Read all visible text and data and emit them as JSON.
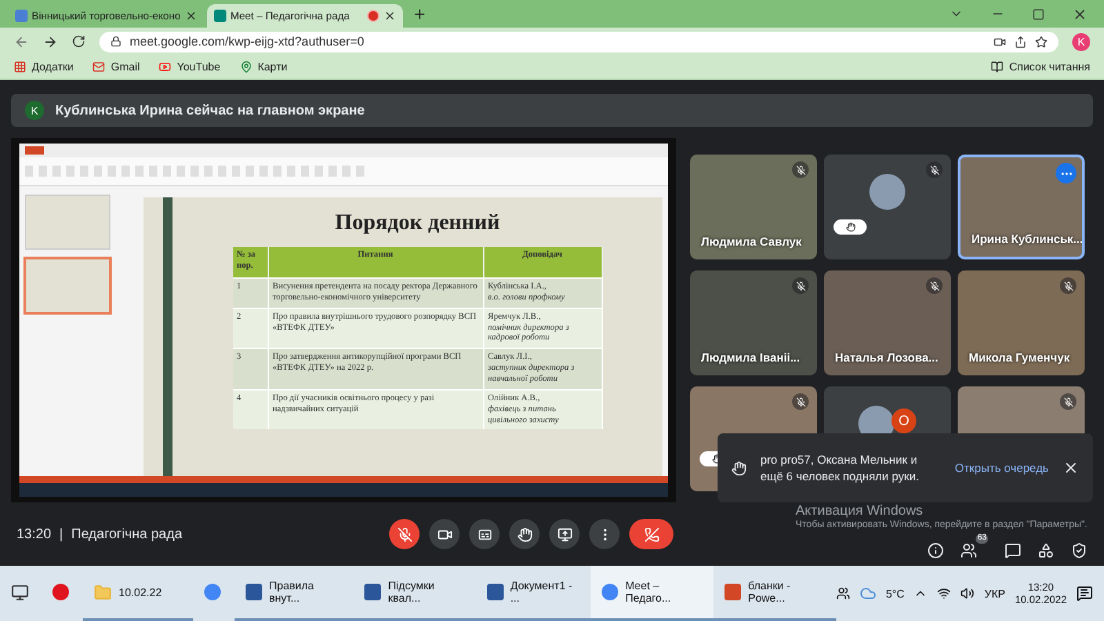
{
  "browser": {
    "tabs": [
      {
        "title": "Вінницький торговельно-еконо",
        "selected": false,
        "recording": false
      },
      {
        "title": "Meet – Педагогічна рада",
        "selected": true,
        "recording": true
      }
    ],
    "new_tab": "+",
    "url": "meet.google.com/kwp-eijg-xtd?authuser=0",
    "profile": "K",
    "bookmarks": [
      {
        "kind": "apps",
        "label": "Додатки"
      },
      {
        "kind": "gmail",
        "label": "Gmail"
      },
      {
        "kind": "youtube",
        "label": "YouTube"
      },
      {
        "kind": "maps",
        "label": "Карти"
      }
    ],
    "reading_list": "Список читання"
  },
  "banner": {
    "avatar": "K",
    "text": "Кублинська Ирина сейчас на главном экране"
  },
  "presentation": {
    "slides": [
      {
        "selected": false
      },
      {
        "selected": true
      }
    ],
    "slide": {
      "title": "Порядок денний",
      "columns": [
        "№ за пор.",
        "Питання",
        "Доповідач"
      ],
      "rows": [
        {
          "number": "1",
          "topic": "Висунення претендента на посаду ректора Державного торговельно-економічного університету",
          "speaker": "Кублінська І.А.,",
          "role": "в.о. голови профкому"
        },
        {
          "number": "2",
          "topic": "Про правила внутрішнього трудового розпорядку ВСП «ВТЕФК ДТЕУ»",
          "speaker": "Яремчук Л.В.,",
          "role": "помічник директора з кадрової роботи"
        },
        {
          "number": "3",
          "topic": "Про затвердження антикорупційної програми ВСП «ВТЕФК ДТЕУ» на 2022 р.",
          "speaker": "Савлук Л.І.,",
          "role": "заступник директора з навчальної роботи"
        },
        {
          "number": "4",
          "topic": "Про дії учасників освітнього процесу у разі надзвичайних ситуацій",
          "speaker": "Олійник А.В.,",
          "role": "фахівець з питань цивільного захисту"
        }
      ]
    }
  },
  "participants": [
    {
      "kind": "video",
      "name": "Людмила Савлук",
      "muted": true,
      "selected": false,
      "hand_raised": false
    },
    {
      "kind": "avatar",
      "avatars": [
        {
          "kind": "photo"
        }
      ],
      "muted": true,
      "selected": false,
      "hand_raised": true
    },
    {
      "kind": "video",
      "name": "Ирина Кублинськ...",
      "muted": false,
      "selected": true,
      "hand_raised": false
    },
    {
      "kind": "video",
      "name": "Людмила Іваніі...",
      "muted": true,
      "selected": false,
      "hand_raised": false
    },
    {
      "kind": "video",
      "name": "Наталья Лозова...",
      "muted": true,
      "selected": false,
      "hand_raised": false
    },
    {
      "kind": "video",
      "name": "Микола Гуменчук",
      "muted": true,
      "selected": false,
      "hand_raised": false
    },
    {
      "kind": "video",
      "muted": true,
      "selected": false,
      "hand_raised": true
    },
    {
      "kind": "avatar",
      "avatars": [
        {
          "kind": "photo"
        },
        {
          "kind": "letter",
          "letter": "O"
        }
      ],
      "muted": false,
      "selected": false,
      "hand_raised": false
    },
    {
      "kind": "video",
      "muted": true,
      "selected": false,
      "hand_raised": false
    }
  ],
  "notification": {
    "text": "pro pro57, Оксана Мельник и ещё 6 человек подняли руки.",
    "action": "Открыть очередь"
  },
  "activation": {
    "title": "Активация Windows",
    "text": "Чтобы активировать Windows, перейдите в раздел \"Параметры\"."
  },
  "meeting": {
    "time": "13:20",
    "separator": "|",
    "title": "Педагогічна рада",
    "people_count": "63",
    "mic_on": false
  },
  "taskbar": {
    "items": [
      {
        "kind": "opera"
      },
      {
        "kind": "folder",
        "label": "10.02.22"
      },
      {
        "kind": "chrome"
      },
      {
        "kind": "word",
        "label": "Правила внут..."
      },
      {
        "kind": "word",
        "label": "Підсумки квал..."
      },
      {
        "kind": "word",
        "label": "Документ1 - ..."
      },
      {
        "kind": "chrome",
        "label": "Meet – Педаго...",
        "selected": true
      },
      {
        "kind": "powerpoint",
        "label": "бланки - Powe..."
      }
    ],
    "weather": "5°C",
    "language": "УКР",
    "time": "13:20",
    "date": "10.02.2022"
  }
}
